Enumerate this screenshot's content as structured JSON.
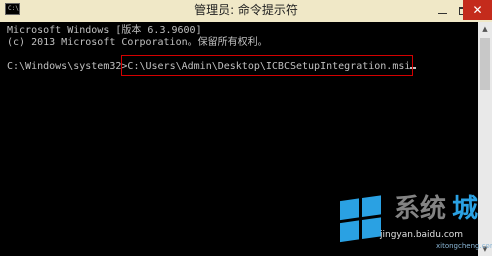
{
  "window": {
    "title": "管理员: 命令提示符",
    "icon": "cmd-icon",
    "icon_label": "C:\\",
    "controls": {
      "minimize_icon": "minimize-icon",
      "maximize_icon": "maximize-icon",
      "close_label": "✕"
    }
  },
  "console": {
    "lines": [
      "Microsoft Windows [版本 6.3.9600]",
      "(c) 2013 Microsoft Corporation。保留所有权利。"
    ],
    "prompt": "C:\\Windows\\system32>",
    "command": "C:\\Users\\Admin\\Desktop\\ICBCSetupIntegration.msi"
  },
  "scrollbar": {
    "up_arrow": "▲",
    "down_arrow": "▼"
  },
  "watermark": {
    "logo": "windows-logo-icon",
    "brand": "系统",
    "brand_accent": "城",
    "url_primary": "jingyan.baidu.com",
    "url_secondary": "xitongcheng.com"
  },
  "colors": {
    "titlebar_bg": "#f0e8c7",
    "console_bg": "#000000",
    "console_text": "#c0c0c0",
    "highlight_border": "#d40000",
    "close_button_bg": "#c42b1c",
    "logo_blue": "#2aa1e3"
  }
}
